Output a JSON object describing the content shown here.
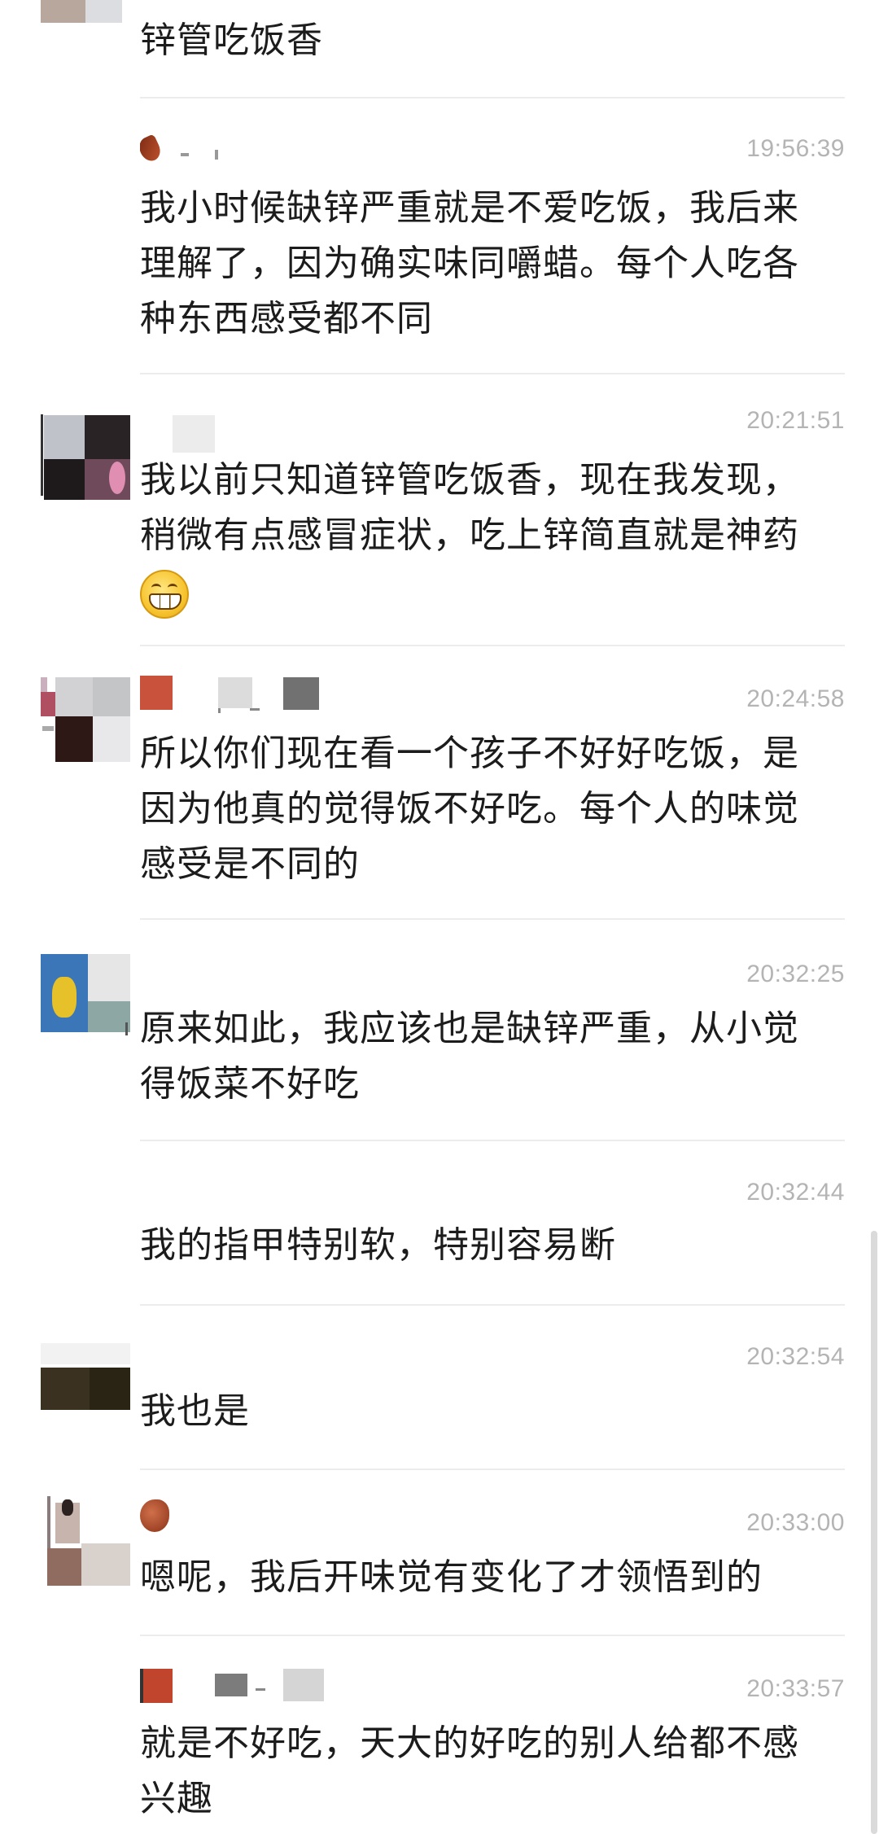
{
  "comments": [
    {
      "id": "c0",
      "time": "",
      "text": "锌管吃饭香",
      "has_emoji": false
    },
    {
      "id": "c1",
      "time": "19:56:39",
      "text": "我小时候缺锌严重就是不爱吃饭，我后来理解了，因为确实味同嚼蜡。每个人吃各种东西感受都不同",
      "has_emoji": false
    },
    {
      "id": "c2",
      "time": "20:21:51",
      "text": "我以前只知道锌管吃饭香，现在我发现，稍微有点感冒症状，吃上锌简直就是神药",
      "has_emoji": true,
      "emoji_name": "grin-emoji"
    },
    {
      "id": "c3",
      "time": "20:24:58",
      "text": "所以你们现在看一个孩子不好好吃饭，是因为他真的觉得饭不好吃。每个人的味觉感受是不同的",
      "has_emoji": false
    },
    {
      "id": "c4",
      "time": "20:32:25",
      "text": "原来如此，我应该也是缺锌严重，从小觉得饭菜不好吃",
      "has_emoji": false
    },
    {
      "id": "c5",
      "time": "20:32:44",
      "text": "我的指甲特别软，特别容易断",
      "has_emoji": false
    },
    {
      "id": "c6",
      "time": "20:32:54",
      "text": "我也是",
      "has_emoji": false
    },
    {
      "id": "c7",
      "time": "20:33:00",
      "text": "嗯呢，我后开味觉有变化了才领悟到的",
      "has_emoji": false
    },
    {
      "id": "c8",
      "time": "20:33:57",
      "text": "就是不好吃，天大的好吃的别人给都不感兴趣",
      "has_emoji": false
    }
  ],
  "colors": {
    "timestamp": "#b4b4b4",
    "text": "#1c1c1c",
    "separator": "#ececec",
    "scrollbar": "#dadada"
  }
}
